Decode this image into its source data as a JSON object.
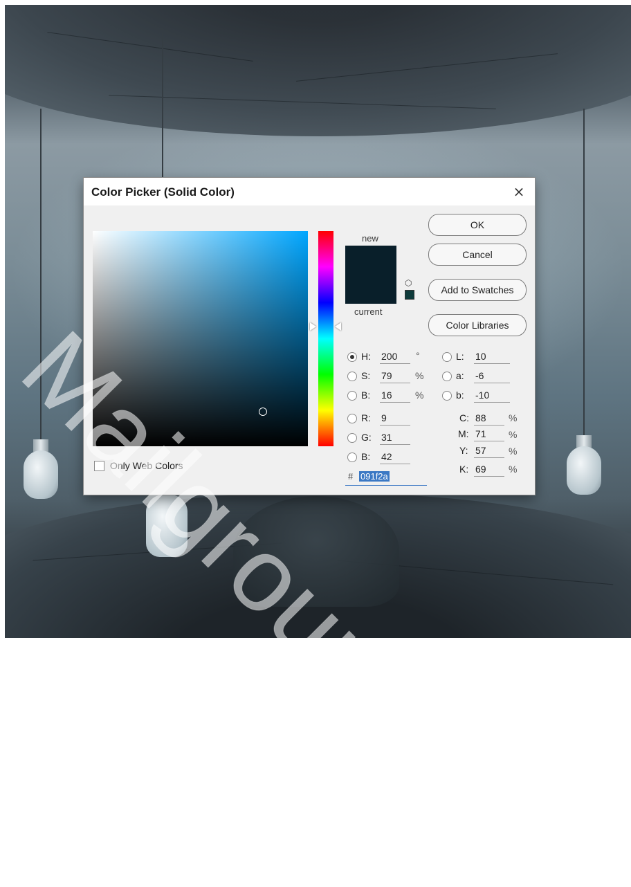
{
  "watermark": "Mailgroup.com",
  "dialog": {
    "title": "Color Picker (Solid Color)",
    "close_glyph": "×",
    "new_label": "new",
    "current_label": "current",
    "buttons": {
      "ok": "OK",
      "cancel": "Cancel",
      "add_to_swatches": "Add to Swatches",
      "color_libraries": "Color Libraries"
    },
    "only_web_colors": "Only Web Colors",
    "colors": {
      "new": "#091f2a",
      "current": "#091f2a"
    },
    "fields": {
      "H": {
        "label": "H:",
        "value": "200",
        "unit": "°"
      },
      "S": {
        "label": "S:",
        "value": "79",
        "unit": "%"
      },
      "B": {
        "label": "B:",
        "value": "16",
        "unit": "%"
      },
      "R": {
        "label": "R:",
        "value": "9"
      },
      "G": {
        "label": "G:",
        "value": "31"
      },
      "Bl": {
        "label": "B:",
        "value": "42"
      },
      "L": {
        "label": "L:",
        "value": "10"
      },
      "a": {
        "label": "a:",
        "value": "-6"
      },
      "b": {
        "label": "b:",
        "value": "-10"
      },
      "C": {
        "label": "C:",
        "value": "88",
        "unit": "%"
      },
      "M": {
        "label": "M:",
        "value": "71",
        "unit": "%"
      },
      "Y": {
        "label": "Y:",
        "value": "57",
        "unit": "%"
      },
      "K": {
        "label": "K:",
        "value": "69",
        "unit": "%"
      }
    },
    "hex_prefix": "#",
    "hex": "091f2a",
    "selected_channel": "H",
    "icons": {
      "gamut_warning": "cube-icon",
      "web_safe": "web-safe-swatch-icon"
    }
  }
}
